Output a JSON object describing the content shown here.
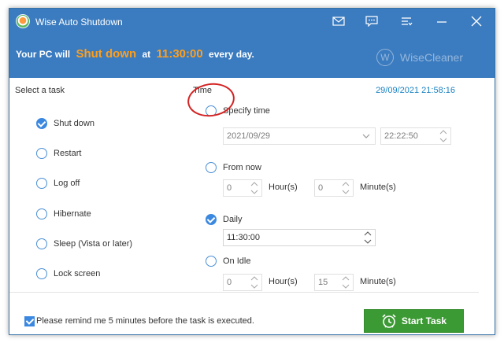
{
  "titlebar": {
    "title": "Wise Auto Shutdown",
    "icons": [
      "mail-icon",
      "feedback-icon",
      "menu-icon",
      "minimize-icon",
      "close-icon"
    ]
  },
  "banner": {
    "prefix": "Your PC will",
    "action": "Shut down",
    "middle": "at",
    "time": "11:30:00",
    "suffix": "every day.",
    "brand_logo_letter": "W",
    "brand_name": "WiseCleaner"
  },
  "tasks": {
    "heading": "Select a task",
    "items": [
      {
        "label": "Shut down",
        "checked": true
      },
      {
        "label": "Restart",
        "checked": false
      },
      {
        "label": "Log off",
        "checked": false
      },
      {
        "label": "Hibernate",
        "checked": false
      },
      {
        "label": "Sleep (Vista or later)",
        "checked": false
      },
      {
        "label": "Lock screen",
        "checked": false
      }
    ]
  },
  "time": {
    "heading": "Time",
    "current_datetime": "29/09/2021 21:58:16",
    "specify": {
      "label": "Specify time",
      "checked": false,
      "date": "2021/09/29",
      "time": "22:22:50"
    },
    "from_now": {
      "label": "From now",
      "checked": false,
      "hours": "0",
      "hours_label": "Hour(s)",
      "minutes": "0",
      "minutes_label": "Minute(s)"
    },
    "daily": {
      "label": "Daily",
      "checked": true,
      "time": "11:30:00"
    },
    "on_idle": {
      "label": "On Idle",
      "checked": false,
      "hours": "0",
      "hours_label": "Hour(s)",
      "minutes": "15",
      "minutes_label": "Minute(s)"
    }
  },
  "footer": {
    "remind_label": "Please remind me 5 minutes before the task is executed.",
    "remind_checked": true,
    "start_label": "Start Task"
  },
  "colors": {
    "header_blue": "#3b7bbf",
    "accent_orange": "#ff9f1c",
    "radio_blue": "#3b88e0",
    "clock_blue": "#1a82c4",
    "start_green": "#3c9a34",
    "annotation_red": "#d42323"
  }
}
